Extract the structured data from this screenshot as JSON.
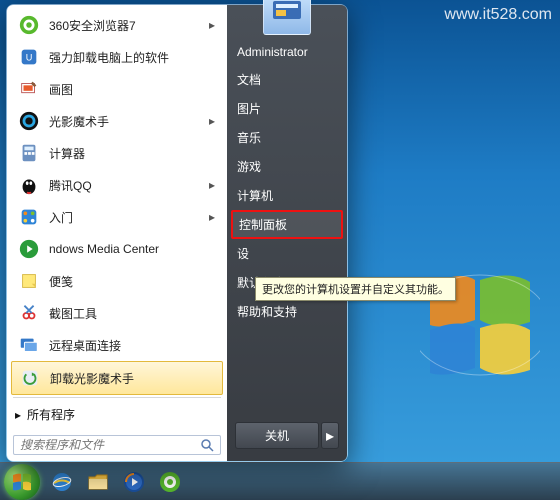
{
  "watermark": "www.it528.com",
  "user": {
    "name": "Administrator"
  },
  "left_programs": [
    {
      "label": "360安全浏览器7",
      "icon": "browser-360-icon",
      "has_arrow": true
    },
    {
      "label": "强力卸载电脑上的软件",
      "icon": "uninstall-tool-icon",
      "has_arrow": false
    },
    {
      "label": "画图",
      "icon": "paint-icon",
      "has_arrow": false
    },
    {
      "label": "光影魔术手",
      "icon": "neoimaging-icon",
      "has_arrow": true
    },
    {
      "label": "计算器",
      "icon": "calculator-icon",
      "has_arrow": false
    },
    {
      "label": "腾讯QQ",
      "icon": "qq-icon",
      "has_arrow": true
    },
    {
      "label": "入门",
      "icon": "getting-started-icon",
      "has_arrow": true
    },
    {
      "label": "ndows Media Center",
      "icon": "media-center-icon",
      "has_arrow": false
    },
    {
      "label": "便笺",
      "icon": "sticky-notes-icon",
      "has_arrow": false
    },
    {
      "label": "截图工具",
      "icon": "snipping-tool-icon",
      "has_arrow": false
    },
    {
      "label": "远程桌面连接",
      "icon": "remote-desktop-icon",
      "has_arrow": false
    },
    {
      "label": "卸载光影魔术手",
      "icon": "uninstall-neoimaging-icon",
      "has_arrow": false,
      "highlighted": true
    }
  ],
  "all_programs_label": "所有程序",
  "search_placeholder": "搜索程序和文件",
  "right_items": [
    {
      "label": "文档",
      "sel": false
    },
    {
      "label": "图片",
      "sel": false
    },
    {
      "label": "音乐",
      "sel": false
    },
    {
      "label": "游戏",
      "sel": false
    },
    {
      "label": "计算机",
      "sel": false
    },
    {
      "label": "控制面板",
      "sel": true
    },
    {
      "label": "设",
      "sel": false
    },
    {
      "label": "默认程序",
      "sel": false
    },
    {
      "label": "帮助和支持",
      "sel": false
    }
  ],
  "shutdown_label": "关机",
  "tooltip": "更改您的计算机设置并自定义其功能。",
  "colors": {
    "highlight": "#e11",
    "hover_bg": "#ffe79b"
  }
}
